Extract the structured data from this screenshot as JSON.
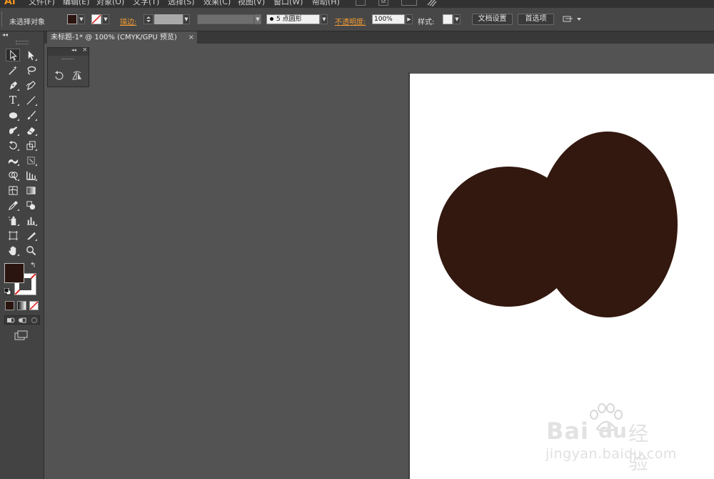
{
  "app": {
    "logo": "Ai",
    "menu": [
      "文件(F)",
      "编辑(E)",
      "对象(O)",
      "文字(T)",
      "选择(S)",
      "效果(C)",
      "视图(V)",
      "窗口(W)",
      "帮助(H)"
    ],
    "menu_icons": [
      "bridge-icon",
      "stock-icon",
      "arrange-documents-icon",
      "sync-icon"
    ],
    "stock_icon_text": "St"
  },
  "controlbar": {
    "selection_status": "未选择对象",
    "fill_color": "#2b1510",
    "stroke_label": "描边:",
    "brush_label": "5 点圆形",
    "opacity_label": "不透明度:",
    "opacity_value": "100%",
    "style_label": "样式:",
    "doc_setup_button": "文档设置",
    "preferences_button": "首选项"
  },
  "document": {
    "tab_title": "未标题-1* @ 100% (CMYK/GPU 预览)",
    "close_glyph": "×"
  },
  "tools": {
    "collapse_glyph": "◂◂",
    "swap_glyph": "↰",
    "fill_color": "#2b1510",
    "type_tool_glyph": "T"
  },
  "float_panel": {
    "collapse_glyph": "◂◂",
    "close_glyph": "×"
  },
  "canvas": {
    "shape_color": "#33180f",
    "background": "#535353",
    "artboard_color": "#ffffff"
  },
  "watermark": {
    "brand": "Bai",
    "brand2": "du",
    "cn": "经验",
    "url": "jingyan.baidu.com"
  }
}
